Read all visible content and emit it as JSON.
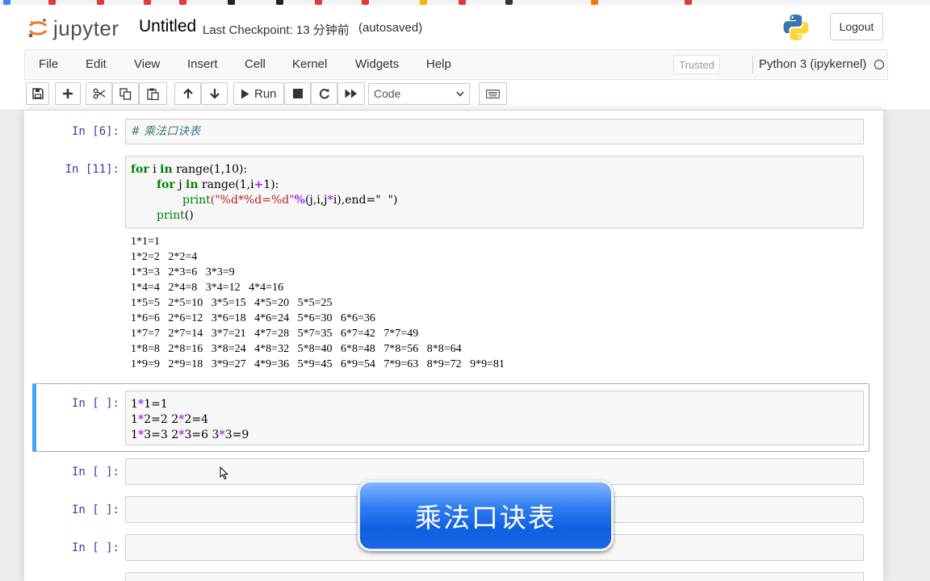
{
  "header": {
    "logo_text": "jupyter",
    "notebook_name": "Untitled",
    "checkpoint_text": "Last Checkpoint: 13 分钟前",
    "autosave_status": "(autosaved)",
    "logout_label": "Logout"
  },
  "menu": {
    "items": [
      "File",
      "Edit",
      "View",
      "Insert",
      "Cell",
      "Kernel",
      "Widgets",
      "Help"
    ],
    "trusted_label": "Trusted",
    "kernel_name": "Python 3 (ipykernel)"
  },
  "toolbar": {
    "run_label": "Run",
    "cell_type_value": "Code"
  },
  "cells": [
    {
      "prompt": "In  [6]:"
    },
    {
      "prompt": "In  [11]:"
    },
    {
      "prompt": "In  [ ]:"
    },
    {
      "prompt": "In  [ ]:"
    },
    {
      "prompt": "In  [ ]:"
    },
    {
      "prompt": "In  [ ]:"
    }
  ],
  "cell0_comment": "# 乘法口诀表",
  "cell1_code": {
    "l1_kw": "for",
    "l1_rest": " i ",
    "l1_in": "in",
    "l1_tail": " range(1,10):",
    "l2_kw": "for",
    "l2_rest": " j ",
    "l2_in": "in",
    "l2_tail": " range(1,i",
    "l2_op": "+",
    "l2_end": "1):",
    "l3_fn": "print",
    "l3_str": "(\"%d*%d=%d\"",
    "l3_op": "%",
    "l3_args": "(j,i,j",
    "l3_op2": "*",
    "l3_end": "i),end=\"  \")",
    "l4_fn": "print",
    "l4_end": "()"
  },
  "output_lines": [
    "1*1=1",
    "1*2=2   2*2=4",
    "1*3=3   2*3=6   3*3=9",
    "1*4=4   2*4=8   3*4=12   4*4=16",
    "1*5=5   2*5=10   3*5=15   4*5=20   5*5=25",
    "1*6=6   2*6=12   3*6=18   4*6=24   5*6=30   6*6=36",
    "1*7=7   2*7=14   3*7=21   4*7=28   5*7=35   6*7=42   7*7=49",
    "1*8=8   2*8=16   3*8=24   4*8=32   5*8=40   6*8=48   7*8=56   8*8=64",
    "1*9=9   2*9=18   3*9=27   4*9=36   5*9=45   6*9=54   7*9=63   8*9=72   9*9=81"
  ],
  "cell2_lines": [
    {
      "a": "1",
      "op": "*",
      "b": "1=1"
    },
    {
      "a": "1",
      "op": "*",
      "b": "2=2 2",
      "op2": "*",
      "c": "2=4"
    },
    {
      "a": "1",
      "op": "*",
      "b": "3=3 2",
      "op2": "*",
      "c": "3=6 3",
      "op3": "*",
      "d": "3=9"
    }
  ],
  "caption_overlay": "乘法口诀表",
  "colors": {
    "prompt": "#303f9f",
    "selected_border": "#42a5f5",
    "keyword": "#008000",
    "string": "#ba2121",
    "operator": "#aa22ff",
    "comment": "#408080"
  },
  "icons": [
    "jupyter-logo",
    "python-logo",
    "save-icon",
    "plus-icon",
    "scissors-icon",
    "copy-icon",
    "paste-icon",
    "arrow-up-icon",
    "arrow-down-icon",
    "play-icon",
    "stop-icon",
    "restart-icon",
    "fast-forward-icon",
    "keyboard-icon",
    "kernel-idle-icon",
    "mouse-cursor-icon"
  ]
}
